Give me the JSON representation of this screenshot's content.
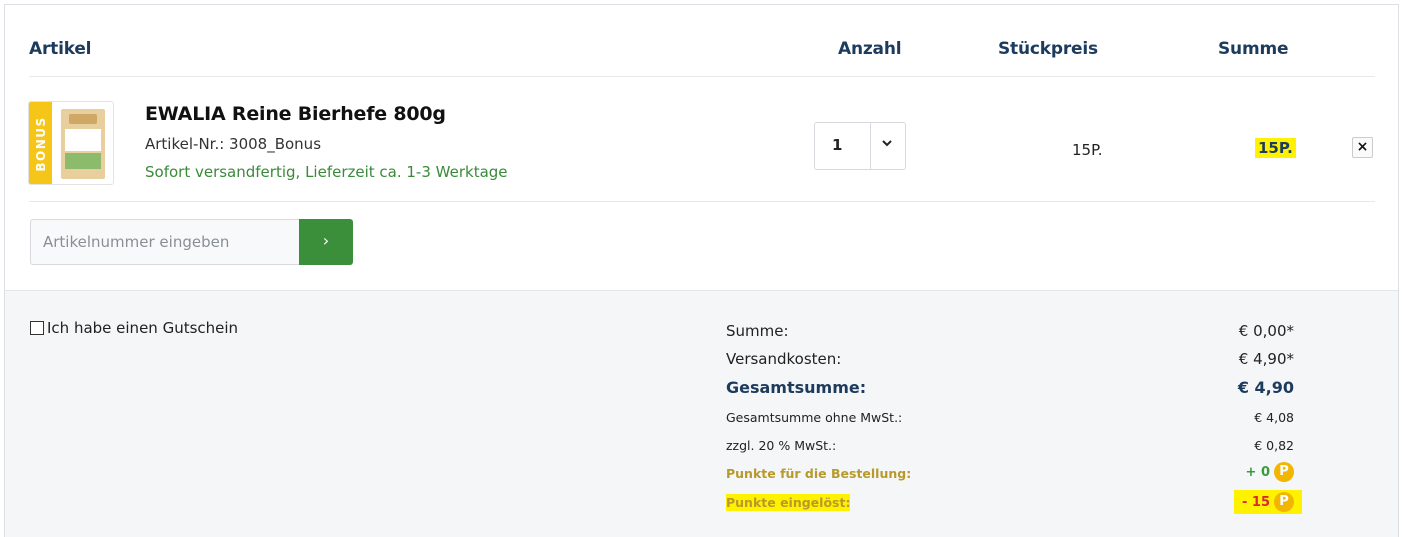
{
  "header": {
    "artikel": "Artikel",
    "anzahl": "Anzahl",
    "stueckpreis": "Stückpreis",
    "summe": "Summe"
  },
  "item": {
    "badge": "BONUS",
    "title": "EWALIA Reine Bierhefe 800g",
    "sku": "Artikel-Nr.: 3008_Bonus",
    "availability": "Sofort versandfertig, Lieferzeit ca. 1-3 Werktage",
    "quantity": "1",
    "unit_price": "15P.",
    "sum": "15P.",
    "delete_symbol": "×"
  },
  "add_article": {
    "placeholder": "Artikelnummer eingeben",
    "button": "›"
  },
  "voucher": {
    "label": "Ich habe einen Gutschein"
  },
  "totals": {
    "summe_label": "Summe:",
    "summe_value": "€ 0,00*",
    "versand_label": "Versandkosten:",
    "versand_value": "€ 4,90*",
    "gesamt_label": "Gesamtsumme:",
    "gesamt_value": "€ 4,90",
    "netto_label": "Gesamtsumme ohne MwSt.:",
    "netto_value": "€ 4,08",
    "mwst_label": "zzgl. 20 % MwSt.:",
    "mwst_value": "€ 0,82",
    "punkte_label": "Punkte für die Bestellung:",
    "punkte_value": "+ 0",
    "eingeloest_label": "Punkte eingelöst:",
    "eingeloest_value": "- 15",
    "coin_symbol": "P"
  },
  "colors": {
    "brand_blue": "#1d3b5c",
    "green": "#3b8f3b",
    "highlight": "#fff200",
    "coin": "#f2b600",
    "bonus_band": "#f5c518"
  }
}
